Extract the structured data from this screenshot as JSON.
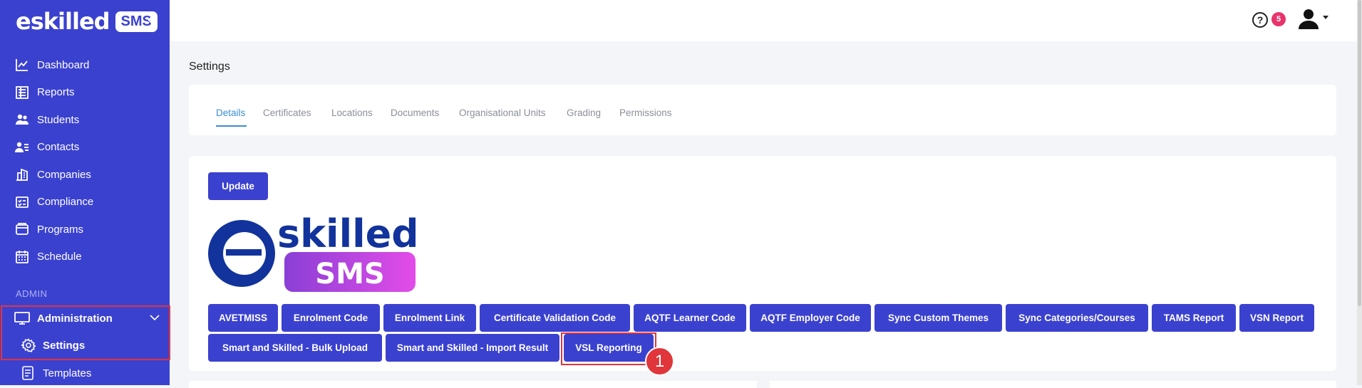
{
  "app": {
    "logo_main": "eskilled",
    "logo_badge": "SMS"
  },
  "sidebar": {
    "collapse_glyph": "«",
    "items": [
      {
        "label": "Dashboard",
        "icon": "chart-line-icon"
      },
      {
        "label": "Reports",
        "icon": "report-icon"
      },
      {
        "label": "Students",
        "icon": "students-icon"
      },
      {
        "label": "Contacts",
        "icon": "contacts-icon"
      },
      {
        "label": "Companies",
        "icon": "building-icon"
      },
      {
        "label": "Compliance",
        "icon": "checklist-icon"
      },
      {
        "label": "Programs",
        "icon": "programs-icon"
      },
      {
        "label": "Schedule",
        "icon": "calendar-icon"
      }
    ],
    "section_title": "ADMIN",
    "administration": {
      "label": "Administration",
      "icon": "monitor-icon"
    },
    "settings": {
      "label": "Settings",
      "icon": "gear-icon"
    },
    "templates": {
      "label": "Templates",
      "icon": "document-icon"
    }
  },
  "topbar": {
    "help_glyph": "?",
    "notification_count": "5"
  },
  "page": {
    "title": "Settings",
    "tabs": [
      "Details",
      "Certificates",
      "Locations",
      "Documents",
      "Organisational Units",
      "Grading",
      "Permissions"
    ],
    "active_tab": "Details"
  },
  "main": {
    "update_label": "Update",
    "logo_main": "skilled",
    "logo_badge": "SMS",
    "buttons_row1": [
      "AVETMISS",
      "Enrolment Code",
      "Enrolment Link",
      "Certificate Validation Code",
      "AQTF Learner Code",
      "AQTF Employer Code",
      "Sync Custom Themes",
      "Sync Categories/Courses",
      "TAMS Report",
      "VSN Report"
    ],
    "buttons_row2": [
      "Smart and Skilled - Bulk Upload",
      "Smart and Skilled - Import Result",
      "VSL Reporting"
    ],
    "step_marker": "1"
  },
  "colors": {
    "sidebar": "#3b41cf",
    "accent": "#3a8ed4",
    "button": "#3b41cf",
    "highlight": "#e0353b",
    "badge": "#e8336b"
  }
}
